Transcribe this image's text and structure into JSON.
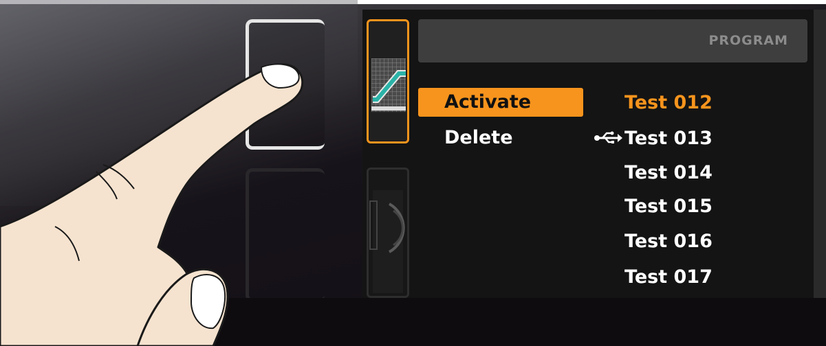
{
  "header": {
    "title": "PROGRAM"
  },
  "menu": {
    "items": [
      {
        "label": "Activate",
        "selected": true
      },
      {
        "label": "Delete",
        "selected": false
      }
    ]
  },
  "programs": [
    {
      "name": "Test 012",
      "active": true,
      "usb": false
    },
    {
      "name": "Test 013",
      "active": false,
      "usb": true
    },
    {
      "name": "Test 014",
      "active": false,
      "usb": false
    },
    {
      "name": "Test 015",
      "active": false,
      "usb": false
    },
    {
      "name": "Test 016",
      "active": false,
      "usb": false
    },
    {
      "name": "Test 017",
      "active": false,
      "usb": false
    }
  ],
  "icons": {
    "tile_program": "incline-ramp-icon",
    "tile_2": "arc-wheel-icon",
    "usb": "usb-icon"
  },
  "colors": {
    "accent": "#f7941d",
    "text": "#ffffff",
    "header_bg": "#3e3e3e",
    "header_text": "#8c8c8c",
    "screen_bg": "#141414"
  }
}
